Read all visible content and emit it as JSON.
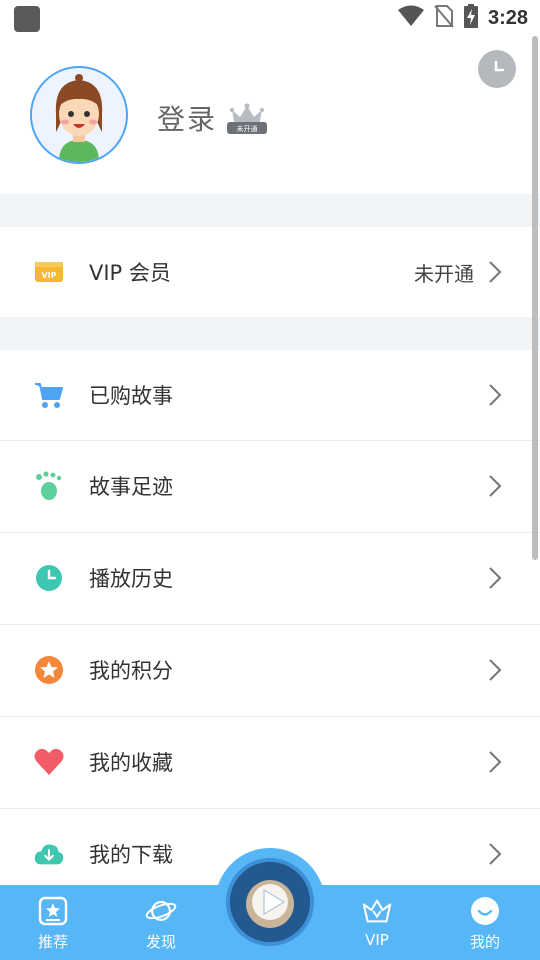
{
  "status_bar": {
    "time": "3:28"
  },
  "header": {
    "login_label": "登录",
    "vip_badge_text": "未开通"
  },
  "vip_row": {
    "label": "VIP 会员",
    "value": "未开通"
  },
  "menu": {
    "items": [
      {
        "label": "已购故事",
        "icon": "cart-icon",
        "color": "#4da3f5"
      },
      {
        "label": "故事足迹",
        "icon": "footprint-icon",
        "color": "#5ccf9a"
      },
      {
        "label": "播放历史",
        "icon": "clock-icon",
        "color": "#3ec7b0"
      },
      {
        "label": "我的积分",
        "icon": "star-icon",
        "color": "#f5873a"
      },
      {
        "label": "我的收藏",
        "icon": "heart-icon",
        "color": "#f25c67"
      },
      {
        "label": "我的下载",
        "icon": "download-cloud-icon",
        "color": "#3ec7b0"
      }
    ]
  },
  "bottom_nav": {
    "items": [
      {
        "label": "推荐",
        "icon": "recommend-icon"
      },
      {
        "label": "发现",
        "icon": "planet-icon"
      },
      {
        "label": "VIP",
        "icon": "vip-crown-icon"
      },
      {
        "label": "我的",
        "icon": "smile-icon"
      }
    ]
  },
  "colors": {
    "accent": "#57b6f6",
    "vip_gold": "#f7b733",
    "background_band": "#f1f5f7"
  }
}
